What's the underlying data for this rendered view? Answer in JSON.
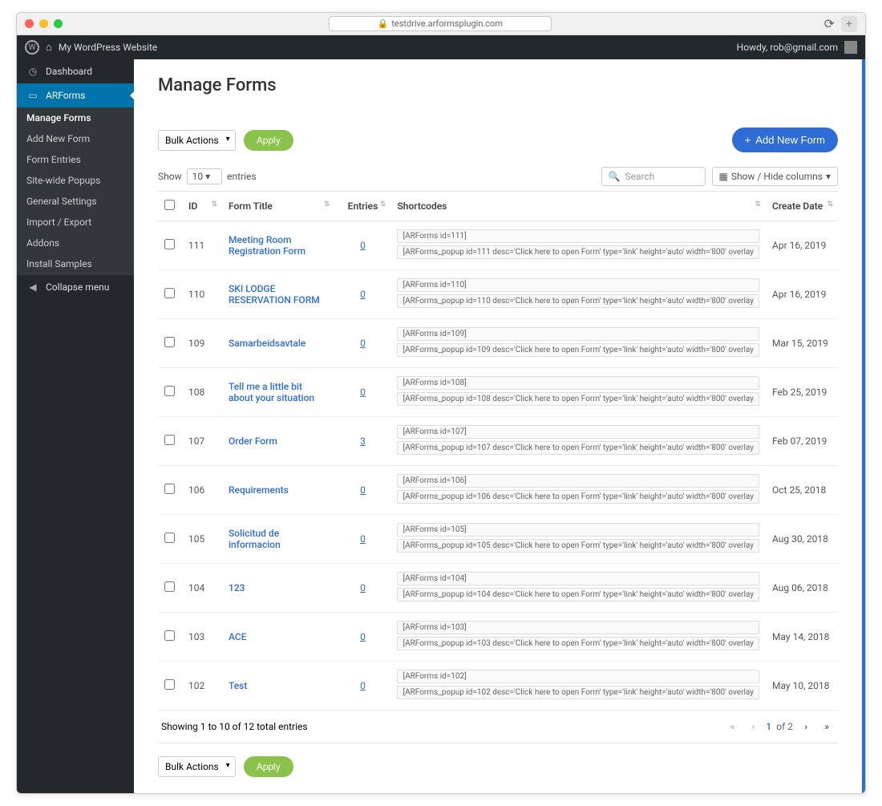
{
  "browser": {
    "url": "testdrive.arformsplugin.com"
  },
  "adminbar": {
    "site": "My WordPress Website",
    "greet": "Howdy, rob@gmail.com"
  },
  "sidebar": {
    "dashboard": "Dashboard",
    "arforms": "ARForms",
    "submenu": [
      "Manage Forms",
      "Add New Form",
      "Form Entries",
      "Site-wide Popups",
      "General Settings",
      "Import / Export",
      "Addons",
      "Install Samples"
    ],
    "collapse": "Collapse menu"
  },
  "page": {
    "title": "Manage Forms",
    "bulk": "Bulk Actions",
    "apply": "Apply",
    "addnew": "Add New Form",
    "show": "Show",
    "entries_label": "entries",
    "per_page": "10",
    "search_placeholder": "Search",
    "columns_btn": "Show / Hide columns",
    "cols": {
      "id": "ID",
      "title": "Form Title",
      "entries": "Entries",
      "shortcodes": "Shortcodes",
      "date": "Create Date"
    },
    "rows": [
      {
        "id": "111",
        "title": "Meeting Room Registration Form",
        "entries": "0",
        "sc1": "[ARForms id=111]",
        "sc2": "[ARForms_popup id=111 desc='Click here to open Form' type='link' height='auto' width='800' overlay",
        "date": "Apr 16, 2019"
      },
      {
        "id": "110",
        "title": "SKI LODGE RESERVATION FORM",
        "entries": "0",
        "sc1": "[ARForms id=110]",
        "sc2": "[ARForms_popup id=110 desc='Click here to open Form' type='link' height='auto' width='800' overlay",
        "date": "Apr 16, 2019"
      },
      {
        "id": "109",
        "title": "Samarbeidsavtale",
        "entries": "0",
        "sc1": "[ARForms id=109]",
        "sc2": "[ARForms_popup id=109 desc='Click here to open Form' type='link' height='auto' width='800' overlay",
        "date": "Mar 15, 2019"
      },
      {
        "id": "108",
        "title": "Tell me a little bit about your situation",
        "entries": "0",
        "sc1": "[ARForms id=108]",
        "sc2": "[ARForms_popup id=108 desc='Click here to open Form' type='link' height='auto' width='800' overlay",
        "date": "Feb 25, 2019"
      },
      {
        "id": "107",
        "title": "Order Form",
        "entries": "3",
        "sc1": "[ARForms id=107]",
        "sc2": "[ARForms_popup id=107 desc='Click here to open Form' type='link' height='auto' width='800' overlay",
        "date": "Feb 07, 2019"
      },
      {
        "id": "106",
        "title": "Requirements",
        "entries": "0",
        "sc1": "[ARForms id=106]",
        "sc2": "[ARForms_popup id=106 desc='Click here to open Form' type='link' height='auto' width='800' overlay",
        "date": "Oct 25, 2018"
      },
      {
        "id": "105",
        "title": "Solicitud de informacion",
        "entries": "0",
        "sc1": "[ARForms id=105]",
        "sc2": "[ARForms_popup id=105 desc='Click here to open Form' type='link' height='auto' width='800' overlay",
        "date": "Aug 30, 2018"
      },
      {
        "id": "104",
        "title": "123",
        "entries": "0",
        "sc1": "[ARForms id=104]",
        "sc2": "[ARForms_popup id=104 desc='Click here to open Form' type='link' height='auto' width='800' overlay",
        "date": "Aug 06, 2018"
      },
      {
        "id": "103",
        "title": "ACE",
        "entries": "0",
        "sc1": "[ARForms id=103]",
        "sc2": "[ARForms_popup id=103 desc='Click here to open Form' type='link' height='auto' width='800' overlay",
        "date": "May 14, 2018"
      },
      {
        "id": "102",
        "title": "Test",
        "entries": "0",
        "sc1": "[ARForms id=102]",
        "sc2": "[ARForms_popup id=102 desc='Click here to open Form' type='link' height='auto' width='800' overlay",
        "date": "May 10, 2018"
      }
    ],
    "footer_info": "Showing 1 to 10 of 12 total entries",
    "page_current": "1",
    "page_of": "of 2"
  }
}
